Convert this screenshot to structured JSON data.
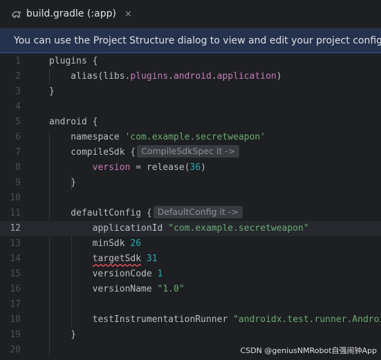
{
  "tab": {
    "title": "build.gradle (:app)",
    "close_glyph": "×",
    "icon": "gradle-elephant-icon"
  },
  "banner": {
    "text": "You can use the Project Structure dialog to view and edit your project configuration"
  },
  "lines": [
    {
      "n": "1",
      "tokens": [
        [
          "plugins {",
          ""
        ]
      ]
    },
    {
      "n": "2",
      "tokens": [
        [
          "    alias(libs.",
          ""
        ],
        [
          "plugins",
          "prop"
        ],
        [
          ".",
          ""
        ],
        [
          "android",
          "prop"
        ],
        [
          ".",
          ""
        ],
        [
          "application",
          "prop"
        ],
        [
          ")",
          ""
        ]
      ]
    },
    {
      "n": "3",
      "tokens": [
        [
          "}",
          ""
        ]
      ]
    },
    {
      "n": "4",
      "tokens": []
    },
    {
      "n": "5",
      "tokens": [
        [
          "android {",
          ""
        ]
      ]
    },
    {
      "n": "6",
      "tokens": [
        [
          "    namespace ",
          ""
        ],
        [
          "'com.example.secretweapon'",
          "str"
        ]
      ]
    },
    {
      "n": "7",
      "tokens": [
        [
          "    compileSdk {",
          ""
        ]
      ],
      "hint": "CompileSdkSpec it ->"
    },
    {
      "n": "8",
      "tokens": [
        [
          "        ",
          ""
        ],
        [
          "version",
          "prop"
        ],
        [
          " = release(",
          ""
        ],
        [
          "36",
          "num"
        ],
        [
          ")",
          ""
        ]
      ]
    },
    {
      "n": "9",
      "tokens": [
        [
          "    }",
          ""
        ]
      ]
    },
    {
      "n": "10",
      "tokens": []
    },
    {
      "n": "11",
      "tokens": [
        [
          "    defaultConfig {",
          ""
        ]
      ],
      "hint": "DefaultConfig it ->"
    },
    {
      "n": "12",
      "tokens": [
        [
          "        applicationId ",
          ""
        ],
        [
          "\"com.example.secretweapon\"",
          "str"
        ]
      ],
      "current": true
    },
    {
      "n": "13",
      "tokens": [
        [
          "        minSdk ",
          ""
        ],
        [
          "26",
          "num"
        ]
      ]
    },
    {
      "n": "14",
      "tokens": [
        [
          "        ",
          ""
        ],
        [
          "targetSdk",
          "err"
        ],
        [
          " ",
          ""
        ],
        [
          "31",
          "num"
        ]
      ]
    },
    {
      "n": "15",
      "tokens": [
        [
          "        versionCode ",
          ""
        ],
        [
          "1",
          "num"
        ]
      ]
    },
    {
      "n": "16",
      "tokens": [
        [
          "        versionName ",
          ""
        ],
        [
          "\"1.0\"",
          "str"
        ]
      ]
    },
    {
      "n": "17",
      "tokens": []
    },
    {
      "n": "18",
      "tokens": [
        [
          "        testInstrumentationRunner ",
          ""
        ],
        [
          "\"androidx.test.runner.AndroidJUnitRunner\"",
          "str"
        ]
      ]
    },
    {
      "n": "19",
      "tokens": [
        [
          "    }",
          ""
        ]
      ]
    },
    {
      "n": "20",
      "tokens": []
    }
  ],
  "watermark": {
    "text": "CSDN @geniusNMRobot自强闹钟App"
  },
  "colors": {
    "string": "#6aab73",
    "number": "#2aacb8",
    "property": "#c77dbb",
    "banner_bg": "#25324d"
  }
}
